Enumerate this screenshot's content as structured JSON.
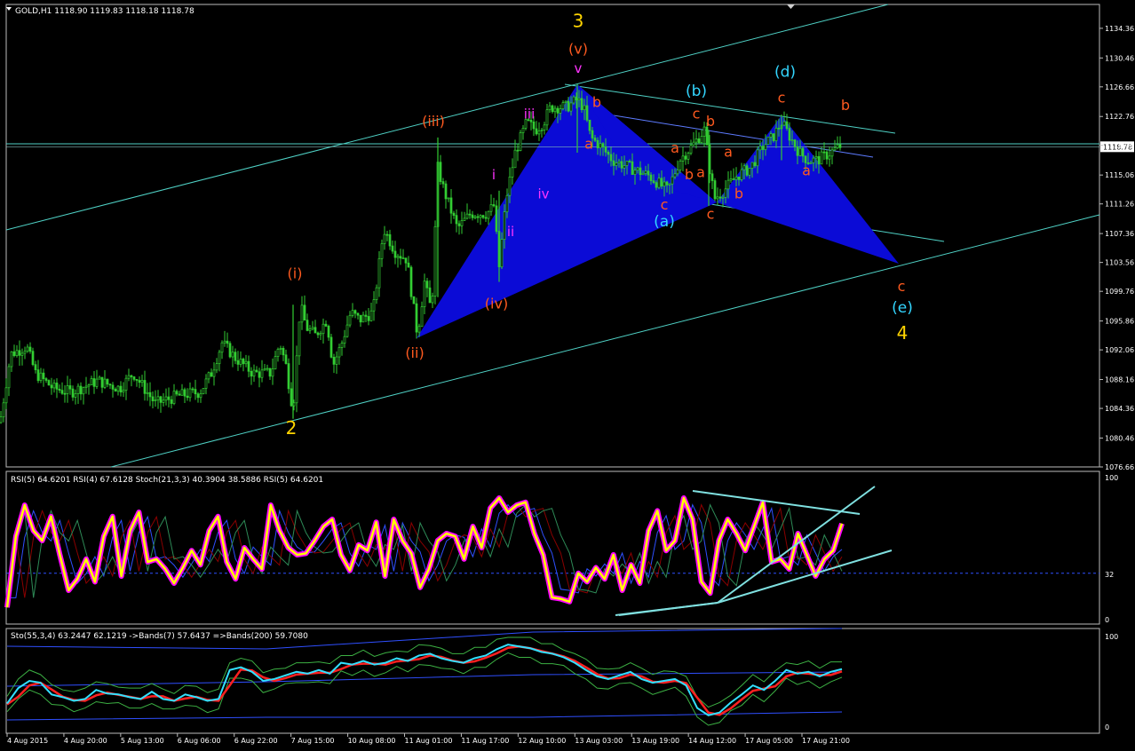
{
  "header": {
    "symbol_line": "GOLD,H1  1118.90 1119.83 1118.18 1118.78"
  },
  "colors": {
    "background": "#000000",
    "candle": "#32cd32",
    "channel": "#4fd1c5",
    "pattern_fill": "#0b0bd6",
    "rsi5": "#ffff00",
    "rsi5_glow": "#ff00ff",
    "yellow_label": "#ffd400",
    "orange_label": "#ff5a1f",
    "cyan_label": "#33d6ff",
    "magenta_label": "#ff33ff"
  },
  "chart_data": [
    {
      "type": "candlestick",
      "title": "",
      "symbol": "GOLD,H1",
      "ohlc": {
        "open": 1118.9,
        "high": 1119.83,
        "low": 1118.18,
        "close": 1118.78
      },
      "ylim": [
        1076.66,
        1137.5
      ],
      "y_ticks": [
        "1134.36",
        "1130.46",
        "1126.66",
        "1122.76",
        "1118.96",
        "1115.06",
        "1111.26",
        "1107.36",
        "1103.56",
        "1099.76",
        "1095.86",
        "1092.06",
        "1088.16",
        "1084.36",
        "1080.46",
        "1076.66"
      ],
      "current_price": "1118.78",
      "x_ticks": [
        "4 Aug 2015",
        "4 Aug 20:00",
        "5 Aug 13:00",
        "6 Aug 06:00",
        "6 Aug 22:00",
        "7 Aug 15:00",
        "10 Aug 08:00",
        "11 Aug 01:00",
        "11 Aug 17:00",
        "12 Aug 10:00",
        "13 Aug 03:00",
        "13 Aug 19:00",
        "14 Aug 12:00",
        "17 Aug 05:00",
        "17 Aug 21:00"
      ],
      "price_path": [
        [
          0,
          1082.5
        ],
        [
          12,
          1091.5
        ],
        [
          30,
          1092.5
        ],
        [
          40,
          1089
        ],
        [
          60,
          1087
        ],
        [
          80,
          1086.5
        ],
        [
          110,
          1088
        ],
        [
          135,
          1087
        ],
        [
          150,
          1089
        ],
        [
          175,
          1085
        ],
        [
          200,
          1086
        ],
        [
          225,
          1086.5
        ],
        [
          238,
          1089
        ],
        [
          250,
          1093
        ],
        [
          265,
          1091
        ],
        [
          285,
          1089
        ],
        [
          305,
          1089
        ],
        [
          315,
          1093
        ],
        [
          322,
          1090
        ],
        [
          330,
          1084
        ],
        [
          338,
          1098
        ],
        [
          345,
          1095
        ],
        [
          355,
          1094
        ],
        [
          368,
          1096
        ],
        [
          375,
          1090
        ],
        [
          385,
          1093
        ],
        [
          395,
          1097
        ],
        [
          405,
          1096
        ],
        [
          420,
          1097
        ],
        [
          432,
          1108
        ],
        [
          445,
          1105
        ],
        [
          458,
          1104
        ],
        [
          470,
          1094
        ],
        [
          478,
          1101
        ],
        [
          486,
          1097
        ],
        [
          493,
          1116
        ],
        [
          500,
          1113
        ],
        [
          515,
          1108
        ],
        [
          530,
          1110
        ],
        [
          548,
          1110
        ],
        [
          556,
          1111
        ],
        [
          562,
          1103
        ],
        [
          570,
          1112
        ],
        [
          580,
          1118
        ],
        [
          593,
          1122
        ],
        [
          603,
          1121
        ],
        [
          612,
          1122
        ],
        [
          620,
          1124
        ],
        [
          638,
          1124
        ],
        [
          650,
          1125
        ],
        [
          657,
          1124
        ],
        [
          665,
          1120
        ],
        [
          675,
          1119
        ],
        [
          690,
          1117
        ],
        [
          710,
          1116
        ],
        [
          730,
          1115
        ],
        [
          752,
          1113
        ],
        [
          765,
          1117
        ],
        [
          780,
          1119
        ],
        [
          793,
          1121
        ],
        [
          800,
          1115
        ],
        [
          805,
          1112
        ],
        [
          815,
          1113
        ],
        [
          830,
          1115
        ],
        [
          845,
          1116
        ],
        [
          860,
          1119
        ],
        [
          870,
          1120
        ],
        [
          880,
          1122
        ],
        [
          890,
          1120
        ],
        [
          900,
          1118
        ],
        [
          910,
          1117
        ],
        [
          920,
          1117
        ],
        [
          935,
          1118
        ],
        [
          948,
          1119
        ]
      ],
      "wicks": [
        [
          330,
          1083,
          1098
        ],
        [
          493,
          1099,
          1120
        ],
        [
          562,
          1101,
          1113
        ],
        [
          650,
          1118,
          1127
        ],
        [
          880,
          1117,
          1123
        ],
        [
          798,
          1111,
          1121
        ]
      ],
      "elliott_labels": [
        {
          "text": "2",
          "color": "yellow",
          "x": 328,
          "y": 1081
        },
        {
          "text": "3",
          "color": "yellow",
          "x": 651,
          "y": 1134.5
        },
        {
          "text": "(v)",
          "color": "orange",
          "x": 651,
          "y": 1131
        },
        {
          "text": "v",
          "color": "magenta",
          "x": 651,
          "y": 1128.5
        },
        {
          "text": "(i)",
          "color": "orange",
          "x": 332,
          "y": 1101.5
        },
        {
          "text": "(ii)",
          "color": "orange",
          "x": 467,
          "y": 1091
        },
        {
          "text": "(iii)",
          "color": "orange",
          "x": 488,
          "y": 1121.5
        },
        {
          "text": "(iv)",
          "color": "orange",
          "x": 559,
          "y": 1097.5
        },
        {
          "text": "i",
          "color": "magenta",
          "x": 556,
          "y": 1114.5
        },
        {
          "text": "ii",
          "color": "magenta",
          "x": 575,
          "y": 1107
        },
        {
          "text": "iii",
          "color": "magenta",
          "x": 596,
          "y": 1122.5
        },
        {
          "text": "iv",
          "color": "magenta",
          "x": 612,
          "y": 1112
        },
        {
          "text": "b",
          "color": "orange",
          "x": 672,
          "y": 1124
        },
        {
          "text": "a",
          "color": "orange",
          "x": 663,
          "y": 1118.5
        },
        {
          "text": "c",
          "color": "orange",
          "x": 748,
          "y": 1110.5
        },
        {
          "text": "(a)",
          "color": "cyan",
          "x": 748,
          "y": 1108.3
        },
        {
          "text": "a",
          "color": "orange",
          "x": 760,
          "y": 1118
        },
        {
          "text": "b",
          "color": "orange",
          "x": 776,
          "y": 1114.5
        },
        {
          "text": "c",
          "color": "orange",
          "x": 784,
          "y": 1122.5
        },
        {
          "text": "b",
          "color": "orange",
          "x": 800,
          "y": 1121.5
        },
        {
          "text": "a",
          "color": "orange",
          "x": 789,
          "y": 1114.8
        },
        {
          "text": "(b)",
          "color": "cyan",
          "x": 784,
          "y": 1125.5
        },
        {
          "text": "c",
          "color": "orange",
          "x": 800,
          "y": 1109.3
        },
        {
          "text": "a",
          "color": "orange",
          "x": 820,
          "y": 1117.5
        },
        {
          "text": "b",
          "color": "orange",
          "x": 832,
          "y": 1112
        },
        {
          "text": "(d)",
          "color": "cyan",
          "x": 884,
          "y": 1128
        },
        {
          "text": "c",
          "color": "orange",
          "x": 880,
          "y": 1124.6
        },
        {
          "text": "a",
          "color": "orange",
          "x": 908,
          "y": 1115
        },
        {
          "text": "b",
          "color": "orange",
          "x": 952,
          "y": 1123.6
        },
        {
          "text": "c",
          "color": "orange",
          "x": 1015,
          "y": 1099.8
        },
        {
          "text": "(e)",
          "color": "cyan",
          "x": 1016,
          "y": 1097
        },
        {
          "text": "4",
          "color": "yellow",
          "x": 1016,
          "y": 1093.5
        }
      ]
    },
    {
      "type": "line",
      "title": "",
      "header_text": "RSI(5) 64.6201  RSI(4) 67.6128  Stoch(21,3,3) 40.3904 38.5886  RSI(5) 64.6201",
      "ylim": [
        0,
        100
      ],
      "y_ticks": [
        "100",
        "32",
        "0"
      ],
      "level": 32,
      "series": [
        {
          "name": "RSI(5)",
          "values": [
            8,
            58,
            80,
            62,
            55,
            72,
            45,
            20,
            28,
            42,
            26,
            58,
            72,
            30,
            62,
            75,
            40,
            42,
            35,
            25,
            36,
            48,
            38,
            62,
            72,
            40,
            28,
            50,
            42,
            35,
            80,
            62,
            50,
            45,
            46,
            55,
            65,
            70,
            45,
            34,
            52,
            48,
            68,
            30,
            70,
            55,
            46,
            22,
            35,
            55,
            60,
            58,
            42,
            65,
            50,
            78,
            85,
            75,
            80,
            82,
            60,
            45,
            15,
            14,
            12,
            32,
            26,
            36,
            28,
            45,
            20,
            38,
            25,
            62,
            76,
            48,
            55,
            85,
            70,
            26,
            18,
            55,
            70,
            60,
            48,
            65,
            82,
            40,
            42,
            35,
            60,
            45,
            30,
            42,
            48,
            67
          ]
        }
      ]
    },
    {
      "type": "line",
      "title": "",
      "header_text": "Sto(55,3,4) 63.2447 62.1219  ->Bands(7) 57.6437  =>Bands(200) 59.7080",
      "ylim": [
        0,
        100
      ],
      "y_ticks": [
        "100",
        "0"
      ],
      "series": [
        {
          "name": "Sto(55,3,4)",
          "values": [
            25,
            42,
            50,
            48,
            35,
            32,
            28,
            30,
            40,
            36,
            35,
            32,
            30,
            38,
            30,
            28,
            35,
            32,
            28,
            30,
            62,
            65,
            60,
            50,
            52,
            56,
            60,
            58,
            62,
            58,
            70,
            68,
            72,
            68,
            70,
            75,
            72,
            78,
            80,
            75,
            72,
            70,
            75,
            78,
            85,
            90,
            88,
            86,
            82,
            80,
            76,
            70,
            62,
            55,
            52,
            56,
            60,
            52,
            48,
            50,
            52,
            45,
            20,
            12,
            15,
            26,
            35,
            45,
            40,
            50,
            62,
            58,
            60,
            55,
            60,
            63
          ]
        }
      ]
    }
  ]
}
